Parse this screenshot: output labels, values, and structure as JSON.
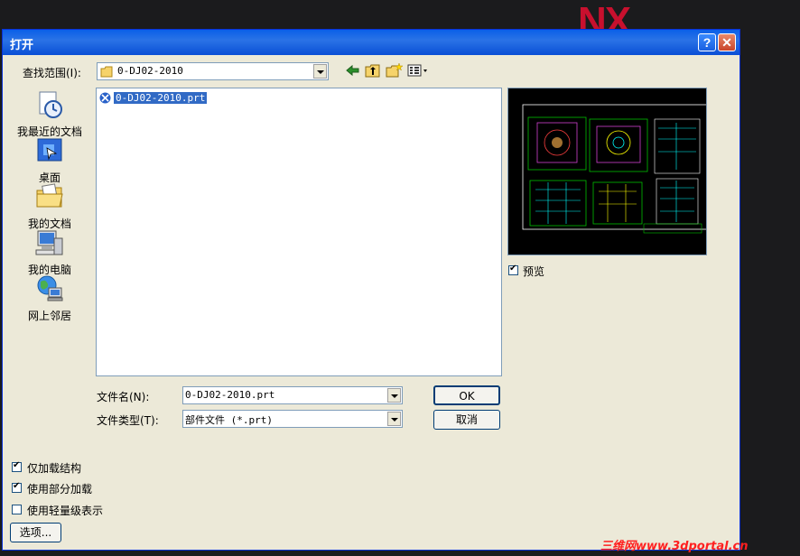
{
  "background": {
    "logo": "NX"
  },
  "dialog": {
    "title": "打开",
    "help_label": "?",
    "close_label": "✕",
    "look_in_label": "查找范围(I):",
    "look_in_value": "0-DJ02-2010",
    "sidebar": [
      {
        "label": "我最近的文档",
        "icon": "recent-documents-icon"
      },
      {
        "label": "桌面",
        "icon": "desktop-icon"
      },
      {
        "label": "我的文档",
        "icon": "my-documents-icon"
      },
      {
        "label": "我的电脑",
        "icon": "my-computer-icon"
      },
      {
        "label": "网上邻居",
        "icon": "network-places-icon"
      }
    ],
    "files": [
      {
        "name": "0-DJ02-2010.prt",
        "selected": true
      }
    ],
    "preview_label": "预览",
    "preview_checked": true,
    "filename_label": "文件名(N):",
    "filename_value": "0-DJ02-2010.prt",
    "filetype_label": "文件类型(T):",
    "filetype_value": "部件文件 (*.prt)",
    "ok_label": "OK",
    "cancel_label": "取消",
    "options": [
      {
        "label": "仅加载结构",
        "checked": true
      },
      {
        "label": "使用部分加载",
        "checked": true
      },
      {
        "label": "使用轻量级表示",
        "checked": false
      }
    ],
    "options_button_label": "选项...",
    "accent_color": "#0a5fe8"
  },
  "watermark": "三维网www.3dportal.cn"
}
